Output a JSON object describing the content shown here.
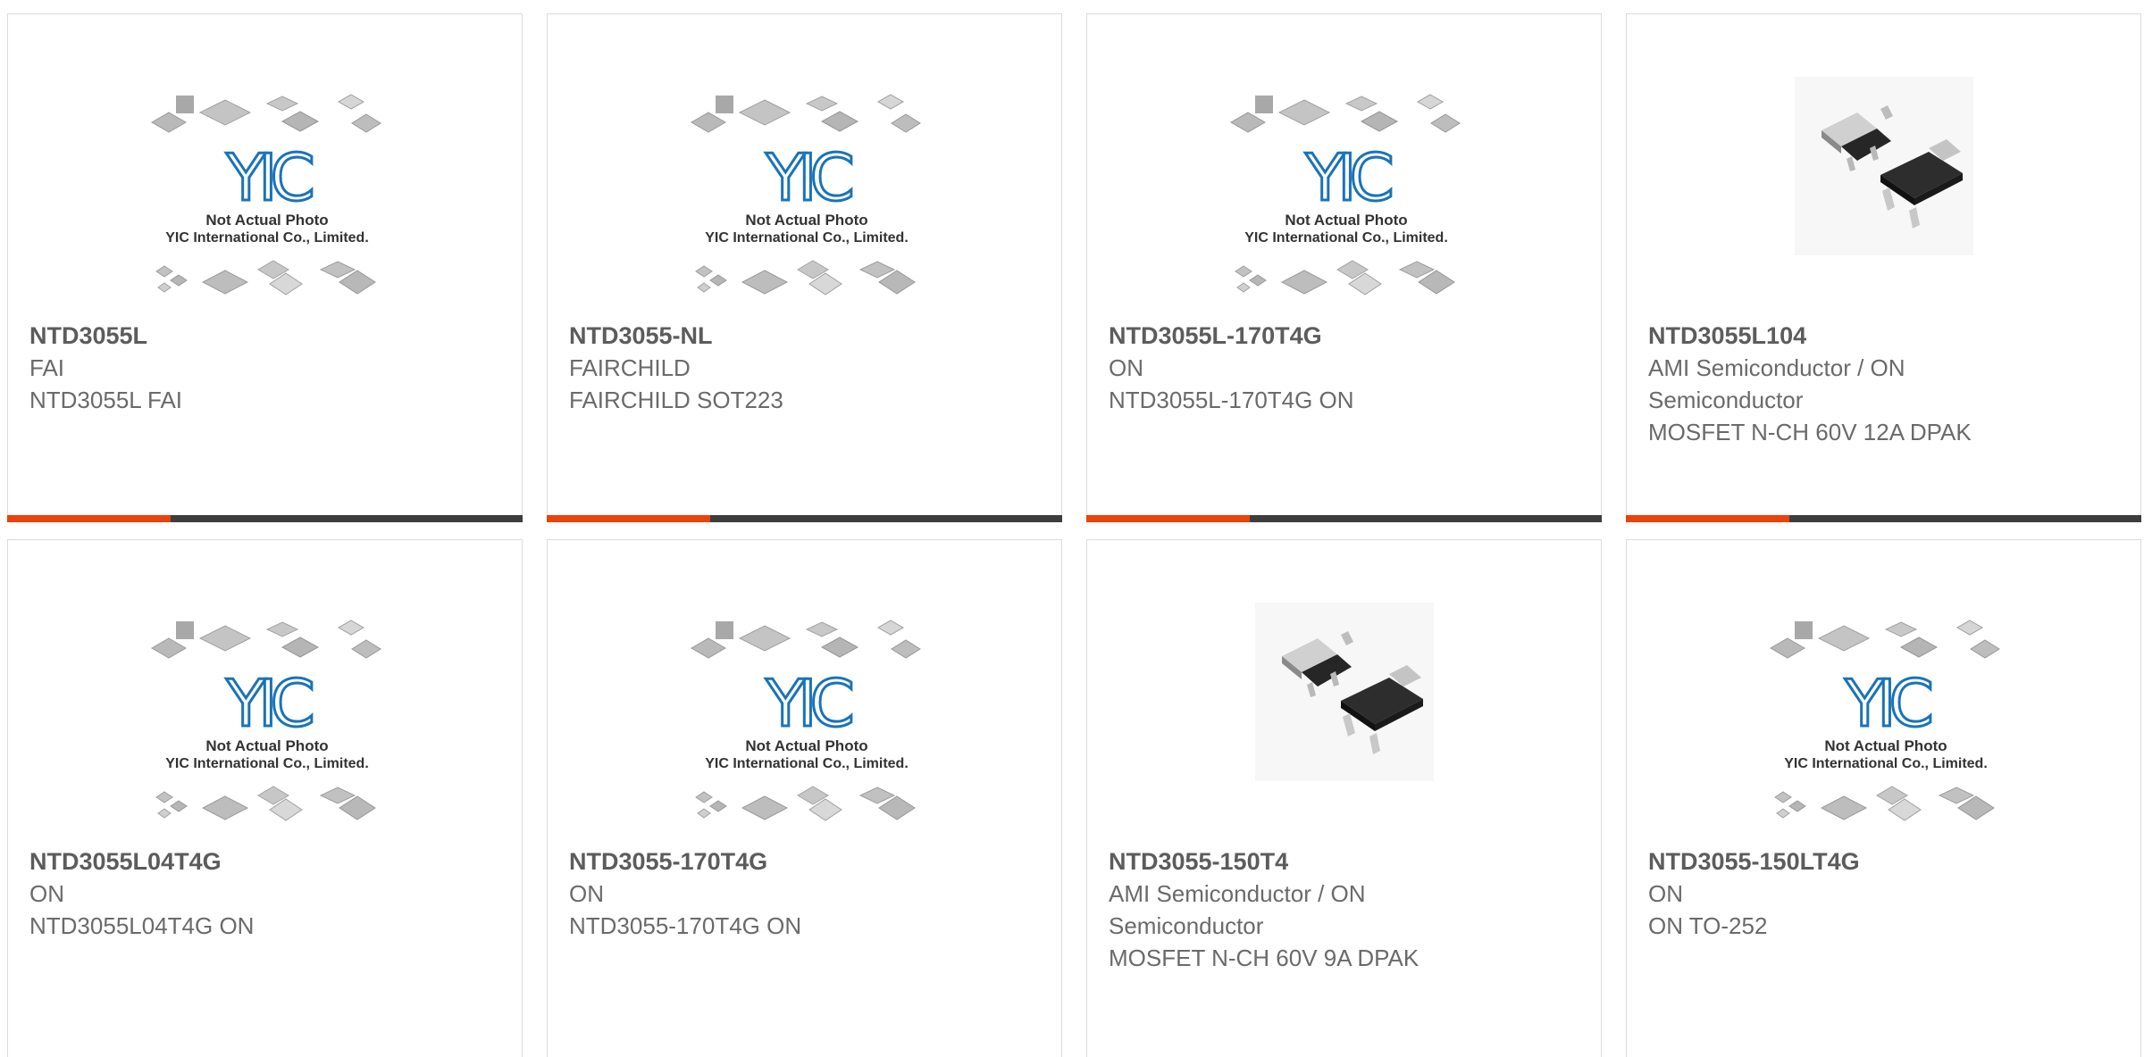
{
  "placeholder": {
    "logo_text": "YIC",
    "line1": "Not Actual Photo",
    "line2": "YIC International Co., Limited.",
    "icon": "ic-chips-placeholder-icon"
  },
  "colors": {
    "accent": "#e8430c",
    "bar": "#3d3d3d",
    "logo": "#1a73b8",
    "title": "#5c5c5c",
    "text": "#6a6a6a"
  },
  "products": [
    {
      "part_number": "NTD3055L",
      "lines": [
        "FAI",
        "NTD3055L FAI"
      ],
      "image": "placeholder"
    },
    {
      "part_number": "NTD3055-NL",
      "lines": [
        "FAIRCHILD",
        "FAIRCHILD SOT223"
      ],
      "image": "placeholder"
    },
    {
      "part_number": "NTD3055L-170T4G",
      "lines": [
        "ON",
        "NTD3055L-170T4G ON"
      ],
      "image": "placeholder"
    },
    {
      "part_number": "NTD3055L104",
      "lines": [
        "AMI Semiconductor / ON",
        "Semiconductor",
        "MOSFET N-CH 60V 12A DPAK"
      ],
      "image": "dpak-photo"
    },
    {
      "part_number": "NTD3055L04T4G",
      "lines": [
        "ON",
        "NTD3055L04T4G ON"
      ],
      "image": "placeholder"
    },
    {
      "part_number": "NTD3055-170T4G",
      "lines": [
        "ON",
        "NTD3055-170T4G ON"
      ],
      "image": "placeholder"
    },
    {
      "part_number": "NTD3055-150T4",
      "lines": [
        "AMI Semiconductor / ON",
        "Semiconductor",
        "MOSFET N-CH 60V 9A DPAK"
      ],
      "image": "dpak-photo"
    },
    {
      "part_number": "NTD3055-150LT4G",
      "lines": [
        "ON",
        "ON TO-252"
      ],
      "image": "placeholder"
    }
  ]
}
